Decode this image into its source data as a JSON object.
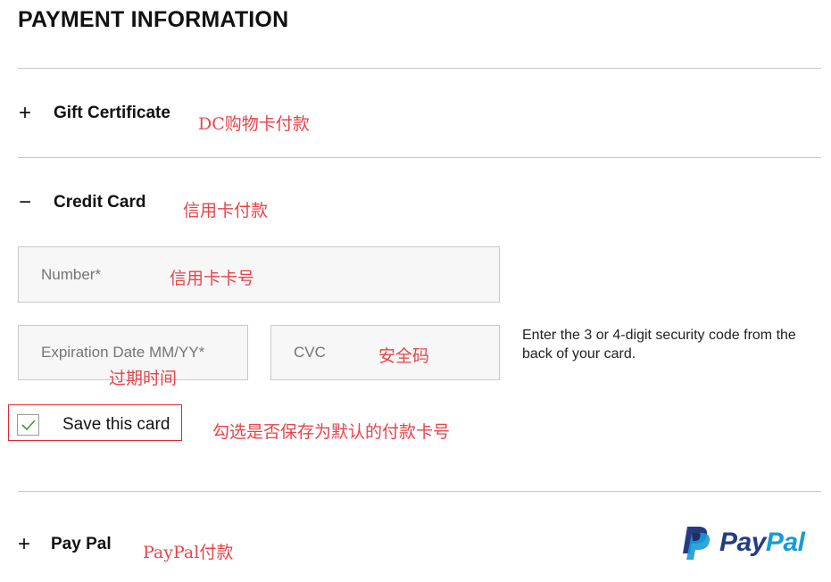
{
  "page_title": "PAYMENT INFORMATION",
  "sections": {
    "gift_certificate": {
      "toggle": "+",
      "label": "Gift Certificate",
      "annotation": "DC购物卡付款"
    },
    "credit_card": {
      "toggle": "−",
      "label": "Credit Card",
      "annotation": "信用卡付款"
    },
    "paypal": {
      "toggle": "+",
      "label": "Pay Pal",
      "annotation": "PayPal付款"
    }
  },
  "credit_card_form": {
    "number": {
      "placeholder": "Number*",
      "annotation": "信用卡卡号"
    },
    "expiration": {
      "placeholder": "Expiration Date MM/YY*",
      "annotation": "过期时间"
    },
    "cvc": {
      "placeholder": "CVC",
      "annotation": "安全码"
    },
    "cvc_hint": "Enter the 3 or 4-digit security code from the back of your card.",
    "save_card": {
      "label": "Save this card",
      "checked": true,
      "annotation": "勾选是否保存为默认的付款卡号"
    }
  },
  "paypal_logo": {
    "text_pay": "Pay",
    "text_pal": "Pal",
    "color_dark": "#253b80",
    "color_light": "#179bd7"
  },
  "colors": {
    "annotation": "#e8434b",
    "highlight_border": "#e0292f",
    "check": "#3a9a3a"
  }
}
